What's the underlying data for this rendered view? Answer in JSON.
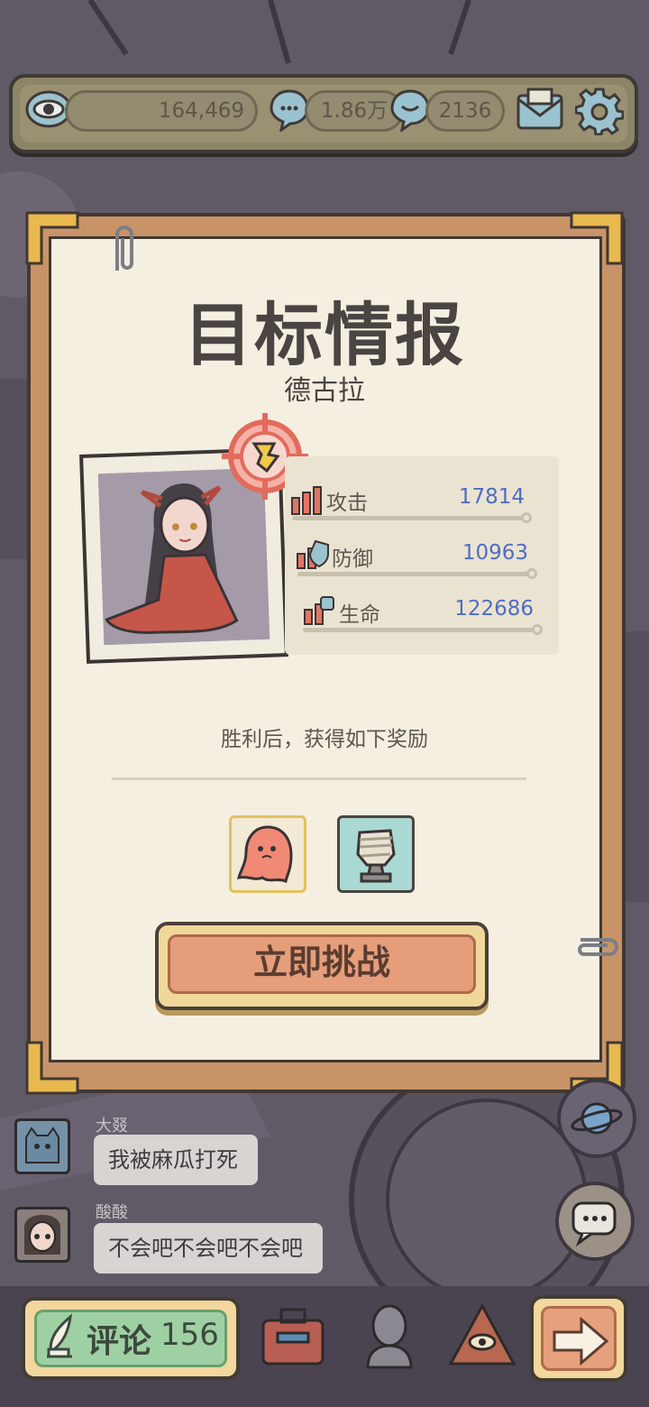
{
  "top_bar": {
    "views_count": "164,469",
    "comments_count": "1.86万",
    "replies_count": "2136",
    "icons": [
      "eye-icon",
      "speech-bubble-icon",
      "chat-bubble-icon",
      "mail-icon",
      "gear-icon"
    ]
  },
  "card": {
    "title": "目标情报",
    "target_name": "德古拉",
    "badge_icon": "target-crosshair-icon",
    "stats": [
      {
        "label": "攻击",
        "value": "17814",
        "icon": "attack-stat-icon"
      },
      {
        "label": "防御",
        "value": "10963",
        "icon": "defense-stat-icon"
      },
      {
        "label": "生命",
        "value": "122686",
        "icon": "health-stat-icon"
      }
    ],
    "reward_text": "胜利后，获得如下奖励",
    "rewards": [
      "red-ghost-reward-icon",
      "mummy-statue-reward-icon"
    ],
    "challenge_button": "立即挑战"
  },
  "chat": {
    "messages": [
      {
        "name": "大叕",
        "text": "我被麻瓜打死"
      },
      {
        "name": "酸酸",
        "text": "不会吧不会吧不会吧"
      }
    ]
  },
  "bottom_bar": {
    "comment_label": "评论",
    "comment_count": "156",
    "nav_icons": [
      "toolbox-icon",
      "bust-statue-icon",
      "pyramid-eye-icon",
      "next-arrow-icon"
    ]
  },
  "colors": {
    "card_frame": "#c89467",
    "paper": "#f4efe0",
    "stat_value": "#4c6ec4",
    "challenge_button": "#e69e7a",
    "comment_button": "#9fd0a4"
  }
}
